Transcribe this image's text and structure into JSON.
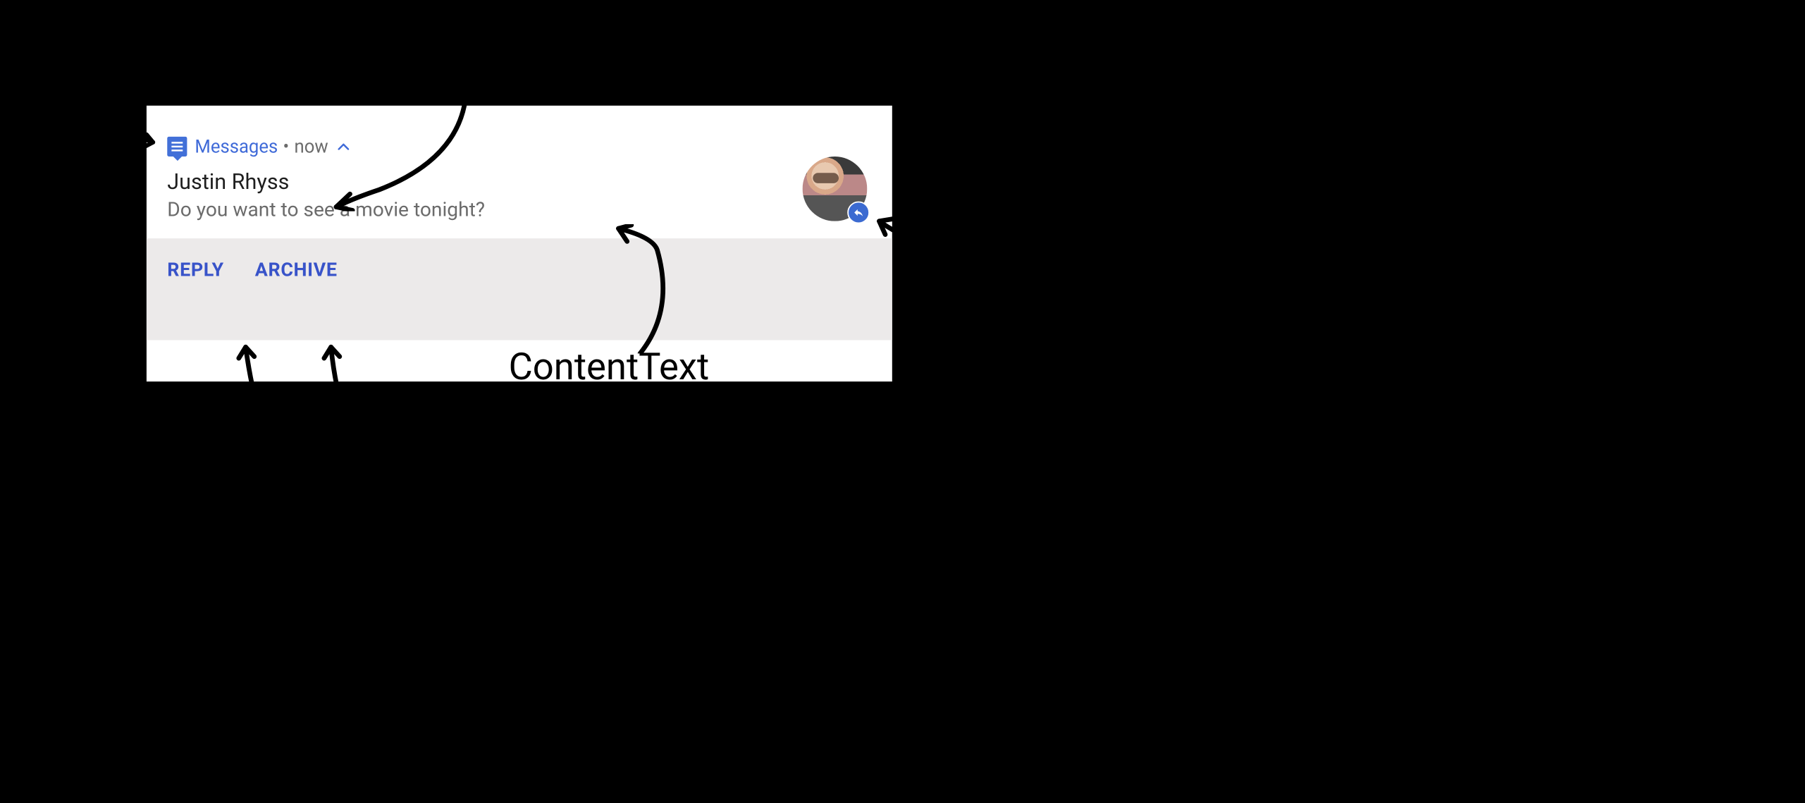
{
  "notification": {
    "app_name": "Messages",
    "separator": "•",
    "timestamp": "now",
    "content_title": "Justin Rhyss",
    "content_text": "Do you want to see a movie tonight?",
    "actions": {
      "reply": "REPLY",
      "archive": "ARCHIVE"
    }
  },
  "annotations": {
    "content_text_label": "ContentText"
  },
  "colors": {
    "accent": "#3f6ad8",
    "action_bg": "#eceaea",
    "text_primary": "#1f1f1f",
    "text_secondary": "#6b6b6b",
    "badge": "#3b6ad1"
  }
}
